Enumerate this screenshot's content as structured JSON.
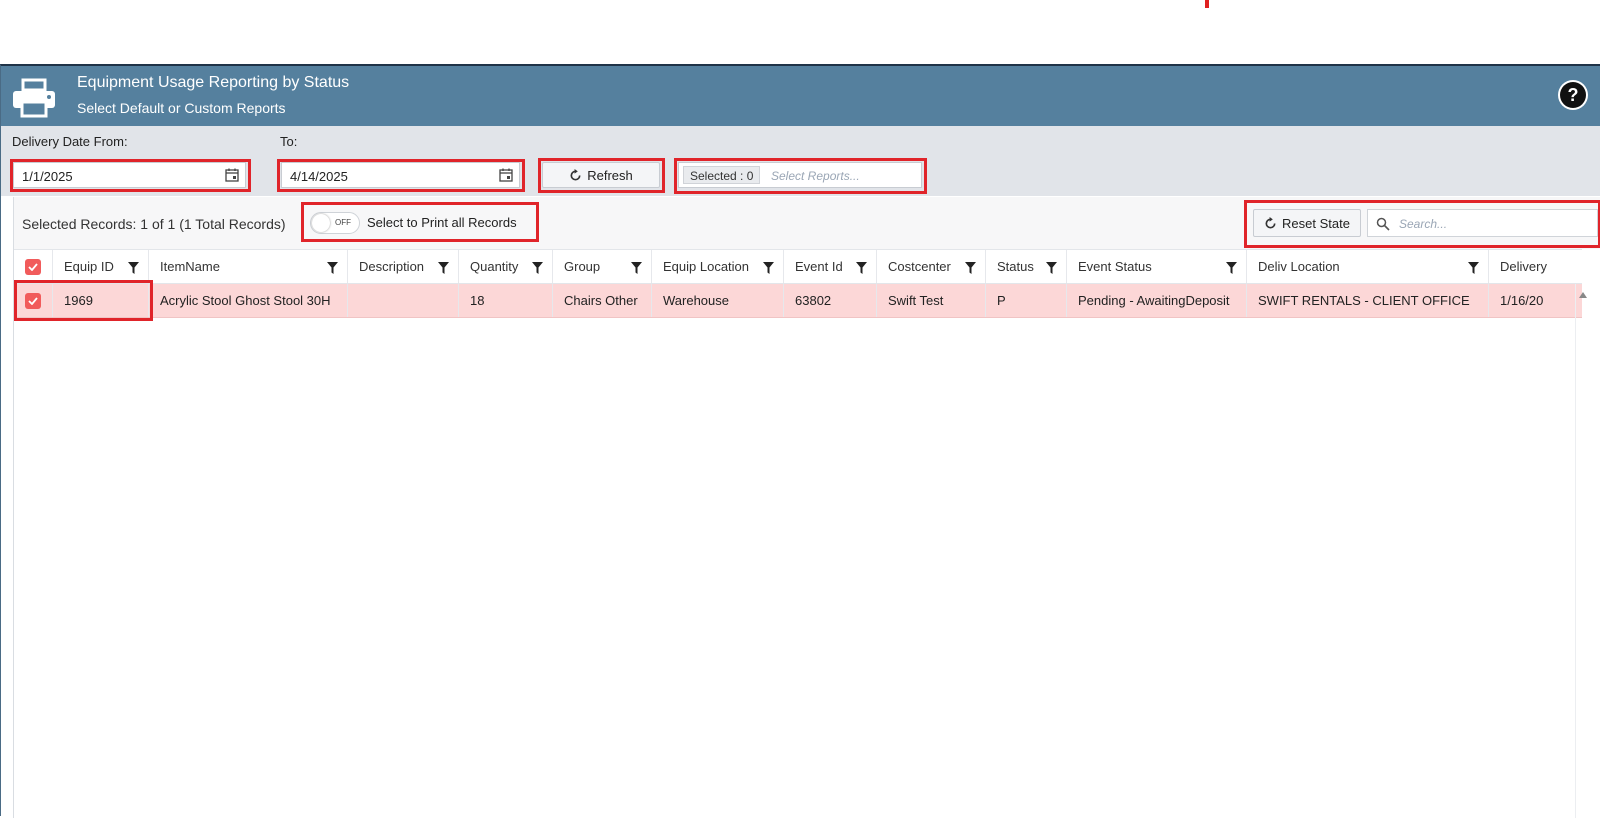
{
  "header": {
    "title": "Equipment Usage Reporting by Status",
    "subtitle": "Select Default or Custom Reports",
    "help_glyph": "?"
  },
  "filters": {
    "date_from_label": "Delivery Date From:",
    "date_from_value": "1/1/2025",
    "date_to_label": "To:",
    "date_to_value": "4/14/2025",
    "refresh_label": "Refresh",
    "reports_selected": "Selected : 0",
    "reports_placeholder": "Select Reports..."
  },
  "toolbar": {
    "records_text": "Selected Records: 1 of 1 (1 Total Records)",
    "toggle_state": "OFF",
    "print_all_label": "Select to Print all Records",
    "reset_label": "Reset State",
    "search_placeholder": "Search..."
  },
  "table": {
    "columns": [
      "Equip ID",
      "ItemName",
      "Description",
      "Quantity",
      "Group",
      "Equip Location",
      "Event Id",
      "Costcenter",
      "Status",
      "Event Status",
      "Deliv Location",
      "Delivery"
    ],
    "rows": [
      {
        "selected": true,
        "cells": [
          "1969",
          "Acrylic Stool Ghost Stool 30H",
          "",
          "18",
          "Chairs Other",
          "Warehouse",
          "63802",
          "Swift Test",
          "P",
          "Pending - AwaitingDeposit",
          "SWIFT RENTALS - CLIENT OFFICE",
          "1/16/20"
        ]
      }
    ]
  },
  "colors": {
    "header_bg": "#55809e",
    "filter_bg": "#e1e4e9",
    "selected_row": "#fcd7d7",
    "checkbox": "#f15b5b",
    "highlight": "#e0242a"
  }
}
